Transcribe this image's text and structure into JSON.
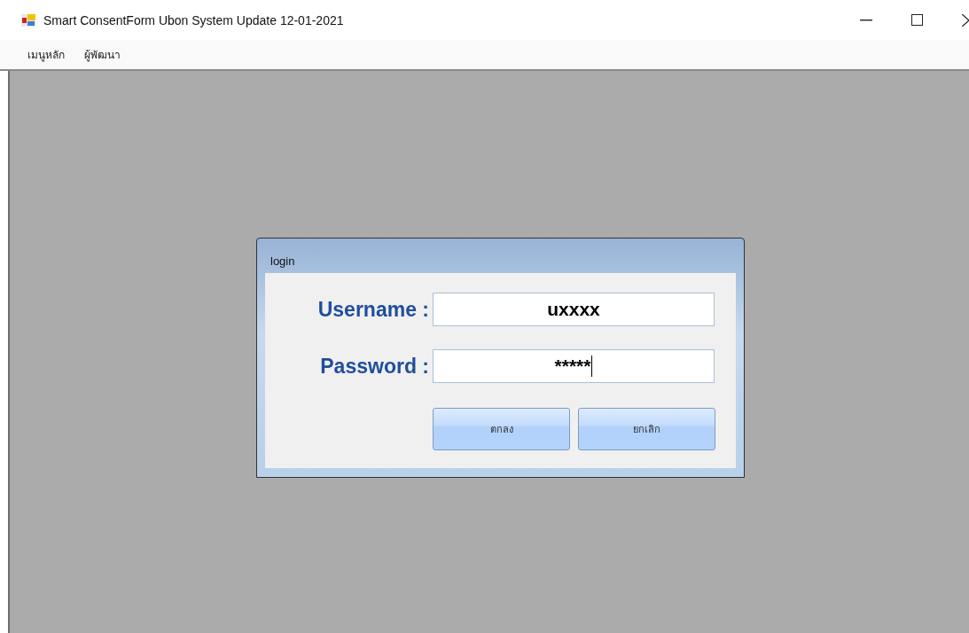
{
  "window": {
    "title": "Smart ConsentForm Ubon System Update 12-01-2021"
  },
  "menu": [
    "เมนูหลัก",
    "ผู้พัฒนา"
  ],
  "dialog": {
    "title": "login",
    "fields": [
      {
        "label": "Username :",
        "value": "uxxxx",
        "focused": false
      },
      {
        "label": "Password :",
        "value": "*****",
        "focused": true
      }
    ],
    "buttons": [
      "ตกลง",
      "ยกเลิก"
    ]
  }
}
